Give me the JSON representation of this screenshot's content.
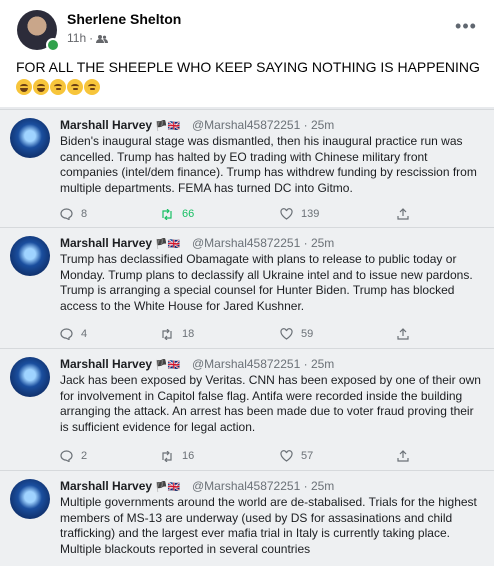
{
  "post": {
    "author": "Sherlene Shelton",
    "time": "11h",
    "separator": "·",
    "text": "FOR ALL THE SHEEPLE WHO KEEP SAYING NOTHING IS HAPPENING",
    "more_glyph": "•••",
    "emojis": [
      "rolling-on-floor-laughing",
      "rolling-on-floor-laughing",
      "thinking-face",
      "thinking-face",
      "thinking-face"
    ]
  },
  "tweets": [
    {
      "name": "Marshall Harvey",
      "flags": "🏴🇬🇧",
      "handle": "@Marshal45872251",
      "dot": "·",
      "time": "25m",
      "body": "Biden's inaugural stage was dismantled, then his inaugural practice run was cancelled. Trump has halted by EO trading with Chinese military front companies (intel/dem finance). Trump has withdrew funding by rescission from multiple departments. FEMA has turned DC into Gitmo.",
      "replies": "8",
      "retweets": "66",
      "likes": "139"
    },
    {
      "name": "Marshall Harvey",
      "flags": "🏴🇬🇧",
      "handle": "@Marshal45872251",
      "dot": "·",
      "time": "25m",
      "body": "Trump has declassified Obamagate with plans to release to public today or Monday. Trump plans to declassify all Ukraine intel and to issue new pardons. Trump is arranging a special counsel for Hunter Biden. Trump has blocked access to the White House for Jared Kushner.",
      "replies": "4",
      "retweets": "18",
      "likes": "59"
    },
    {
      "name": "Marshall Harvey",
      "flags": "🏴🇬🇧",
      "handle": "@Marshal45872251",
      "dot": "·",
      "time": "25m",
      "body": "Jack has been exposed by Veritas. CNN has been exposed by one of their own for involvement in Capitol false flag. Antifa were recorded inside the building arranging the attack. An arrest has been made due to voter fraud proving their is sufficient evidence for legal action.",
      "replies": "2",
      "retweets": "16",
      "likes": "57"
    },
    {
      "name": "Marshall Harvey",
      "flags": "🏴🇬🇧",
      "handle": "@Marshal45872251",
      "dot": "·",
      "time": "25m",
      "body": "Multiple governments around the world are de-stabalised. Trials for the highest members of MS-13 are underway (used by DS for assasinations and child trafficking) and the largest ever mafia trial in Italy is currently taking place. Multiple blackouts reported in several countries"
    }
  ],
  "colors": {
    "retweet_green": "#17bf63",
    "meta_gray": "#65676b",
    "tweet_bg": "#eef0f2"
  }
}
